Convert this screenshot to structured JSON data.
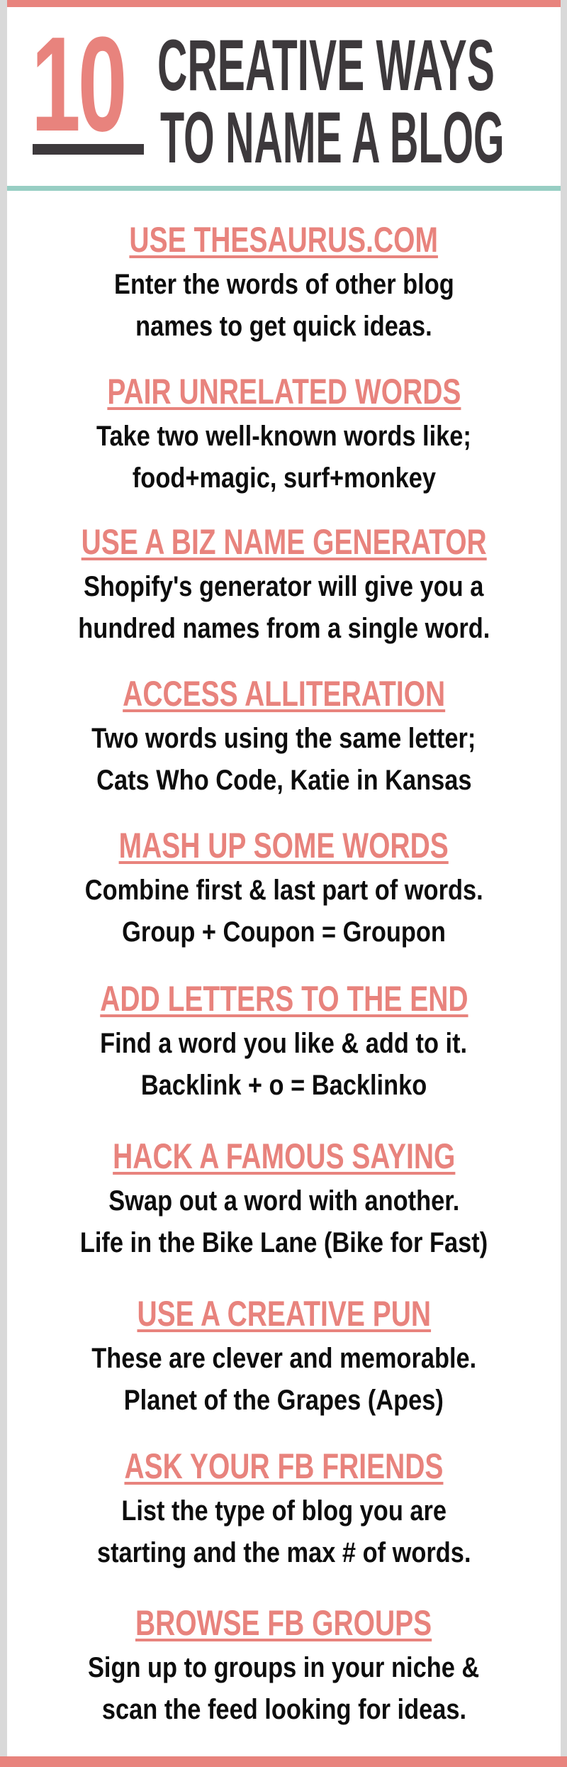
{
  "header": {
    "number": "10",
    "title_line_1": "CREATIVE WAYS",
    "title_line_2": "TO NAME A BLOG"
  },
  "colors": {
    "accent_pink": "#e8837d",
    "title_dark": "#3d393c",
    "divider_teal": "#97cec3",
    "frame_gray": "#d9d9d9",
    "body_text": "#0d0d0d"
  },
  "tips": [
    {
      "heading": "USE THESAURUS.COM",
      "lines": [
        "Enter the words of other blog",
        "names to get quick ideas."
      ]
    },
    {
      "heading": "PAIR UNRELATED WORDS",
      "lines": [
        "Take two well-known words like;",
        "food+magic, surf+monkey"
      ]
    },
    {
      "heading": "USE A BIZ NAME GENERATOR",
      "lines": [
        "Shopify's generator will give you a",
        "hundred names from a single word."
      ]
    },
    {
      "heading": "ACCESS ALLITERATION",
      "lines": [
        "Two words using the same letter;",
        "Cats Who Code, Katie in Kansas"
      ]
    },
    {
      "heading": "MASH UP SOME WORDS",
      "lines": [
        "Combine first & last part of words.",
        "Group + Coupon = Groupon"
      ]
    },
    {
      "heading": "ADD LETTERS TO THE END",
      "lines": [
        "Find a word you like & add to it.",
        "Backlink + o = Backlinko"
      ]
    },
    {
      "heading": "HACK A FAMOUS SAYING",
      "lines": [
        "Swap out a word with another.",
        "Life in the Bike Lane (Bike for Fast)"
      ]
    },
    {
      "heading": "USE A CREATIVE PUN",
      "lines": [
        "These are clever and memorable.",
        "Planet of the Grapes (Apes)"
      ]
    },
    {
      "heading": "ASK YOUR FB FRIENDS",
      "lines": [
        "List the type of blog you are",
        "starting and the max # of words."
      ]
    },
    {
      "heading": "BROWSE FB GROUPS",
      "lines": [
        "Sign up to groups in your niche &",
        "scan the feed looking for ideas."
      ]
    }
  ]
}
